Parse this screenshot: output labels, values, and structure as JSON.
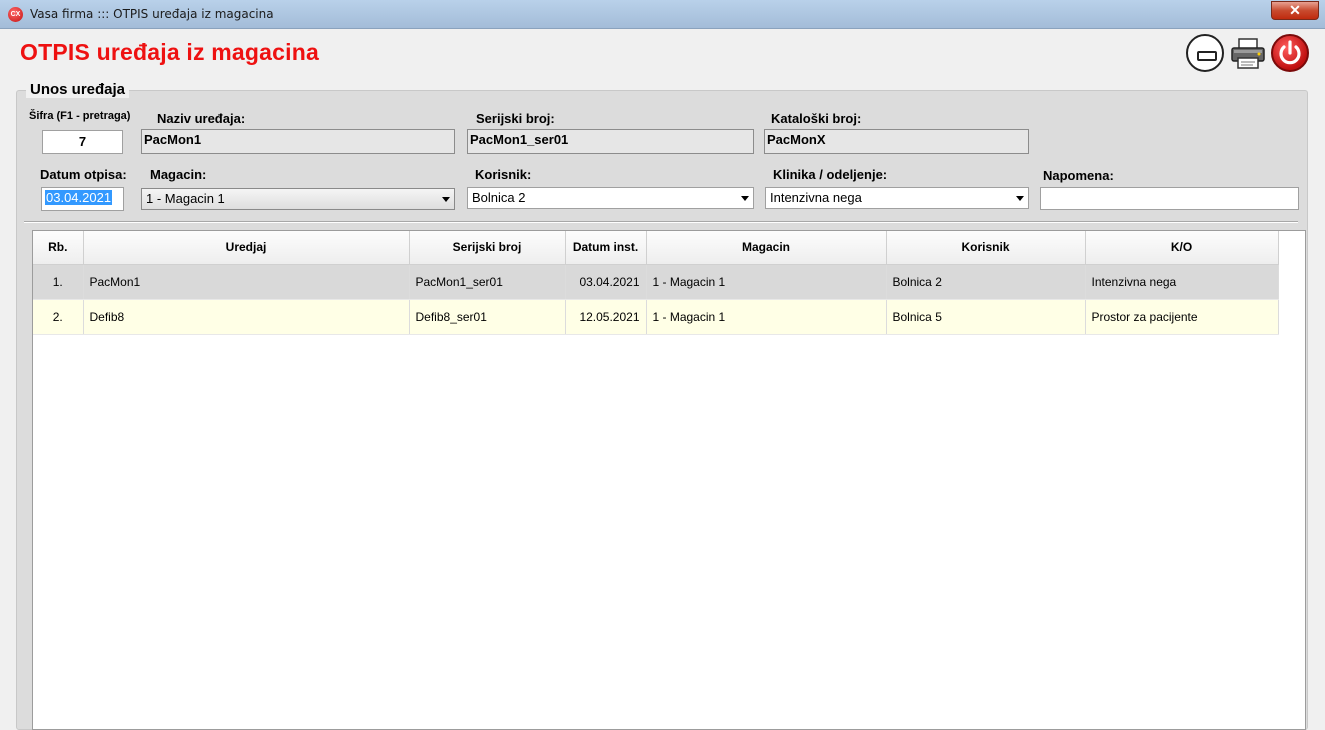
{
  "window": {
    "icon_text": "CX",
    "title": "Vasa firma ::: OTPIS uređaja iz magacina",
    "close_glyph": "✕"
  },
  "header": {
    "page_title": "OTPIS uređaja iz magacina"
  },
  "form": {
    "group_title": "Unos uređaja",
    "sifra_label": "Šifra (F1 - pretraga)",
    "sifra_value": "7",
    "naziv_label": "Naziv uređaja:",
    "naziv_value": "PacMon1",
    "serijski_label": "Serijski broj:",
    "serijski_value": "PacMon1_ser01",
    "katalog_label": "Kataloški broj:",
    "katalog_value": "PacMonX",
    "datum_label": "Datum otpisa:",
    "datum_value": "03.04.2021",
    "magacin_label": "Magacin:",
    "magacin_value": "1 - Magacin 1",
    "korisnik_label": "Korisnik:",
    "korisnik_value": "Bolnica 2",
    "klinika_label": "Klinika / odeljenje:",
    "klinika_value": "Intenzivna nega",
    "napomena_label": "Napomena:",
    "napomena_value": ""
  },
  "grid": {
    "columns": [
      "Rb.",
      "Uredjaj",
      "Serijski broj",
      "Datum inst.",
      "Magacin",
      "Korisnik",
      "K/O"
    ],
    "rows": [
      [
        "1.",
        "PacMon1",
        "PacMon1_ser01",
        "03.04.2021",
        "1 - Magacin 1",
        "Bolnica 2",
        "Intenzivna nega"
      ],
      [
        "2.",
        "Defib8",
        "Defib8_ser01",
        "12.05.2021",
        "1 - Magacin 1",
        "Bolnica 5",
        "Prostor za pacijente"
      ]
    ]
  },
  "colors": {
    "title_red": "#ee1111",
    "row_selected": "#d9d9d9",
    "row_alt": "#ffffe6"
  }
}
